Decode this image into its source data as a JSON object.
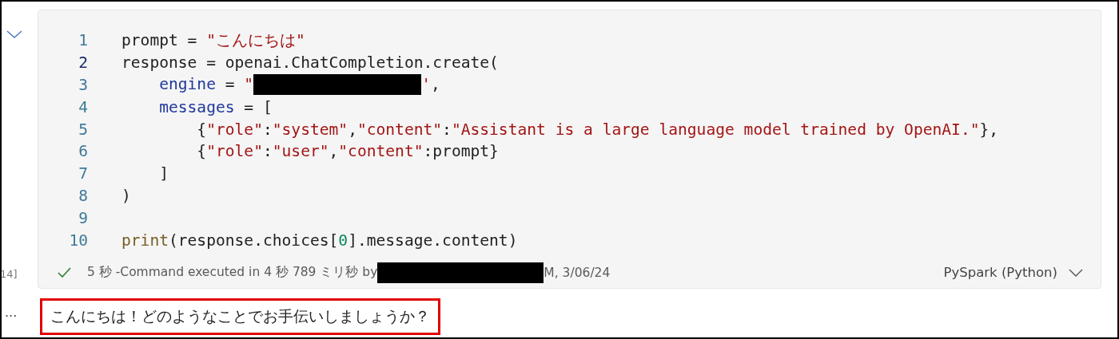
{
  "cell": {
    "code_lines": [
      {
        "number": "1",
        "current": false,
        "tokens": [
          {
            "kind": "plain",
            "text": "prompt = "
          },
          {
            "kind": "string",
            "text": "\"こんにちは\""
          }
        ]
      },
      {
        "number": "2",
        "current": true,
        "tokens": [
          {
            "kind": "plain",
            "text": "response = openai.ChatCompletion.create("
          }
        ]
      },
      {
        "number": "3",
        "current": false,
        "tokens": [
          {
            "kind": "param",
            "text": "    engine"
          },
          {
            "kind": "plain",
            "text": " = "
          },
          {
            "kind": "string",
            "text": "\""
          },
          {
            "kind": "redacted"
          },
          {
            "kind": "string",
            "text": "'"
          },
          {
            "kind": "plain",
            "text": ","
          }
        ]
      },
      {
        "number": "4",
        "current": false,
        "tokens": [
          {
            "kind": "param",
            "text": "    messages"
          },
          {
            "kind": "plain",
            "text": " = ["
          }
        ]
      },
      {
        "number": "5",
        "current": false,
        "tokens": [
          {
            "kind": "plain",
            "text": "        {"
          },
          {
            "kind": "string",
            "text": "\"role\""
          },
          {
            "kind": "plain",
            "text": ":"
          },
          {
            "kind": "string",
            "text": "\"system\""
          },
          {
            "kind": "plain",
            "text": ","
          },
          {
            "kind": "string",
            "text": "\"content\""
          },
          {
            "kind": "plain",
            "text": ":"
          },
          {
            "kind": "string",
            "text": "\"Assistant is a large language model trained by OpenAI.\""
          },
          {
            "kind": "plain",
            "text": "},"
          }
        ]
      },
      {
        "number": "6",
        "current": false,
        "tokens": [
          {
            "kind": "plain",
            "text": "        {"
          },
          {
            "kind": "string",
            "text": "\"role\""
          },
          {
            "kind": "plain",
            "text": ":"
          },
          {
            "kind": "string",
            "text": "\"user\""
          },
          {
            "kind": "plain",
            "text": ","
          },
          {
            "kind": "string",
            "text": "\"content\""
          },
          {
            "kind": "plain",
            "text": ":prompt}"
          }
        ]
      },
      {
        "number": "7",
        "current": false,
        "tokens": [
          {
            "kind": "plain",
            "text": "    ]"
          }
        ]
      },
      {
        "number": "8",
        "current": false,
        "tokens": [
          {
            "kind": "plain",
            "text": ")"
          }
        ]
      },
      {
        "number": "9",
        "current": false
      },
      {
        "number": "10",
        "current": false,
        "tokens": [
          {
            "kind": "func",
            "text": "print"
          },
          {
            "kind": "plain",
            "text": "(response.choices["
          },
          {
            "kind": "number",
            "text": "0"
          },
          {
            "kind": "plain",
            "text": "].message.content)"
          }
        ]
      }
    ],
    "execution_count": "14]",
    "status": {
      "parts": [
        {
          "kind": "text",
          "text": "5 秒 -Command executed in 4 秒 789 ミリ秒 by"
        },
        {
          "kind": "redacted"
        },
        {
          "kind": "text",
          "text": "M, 3/06/24"
        }
      ]
    },
    "language": "PySpark (Python)"
  },
  "output": {
    "more": "···",
    "text": "こんにちは！どのようなことでお手伝いしましょうか？",
    "highlighted": true
  }
}
